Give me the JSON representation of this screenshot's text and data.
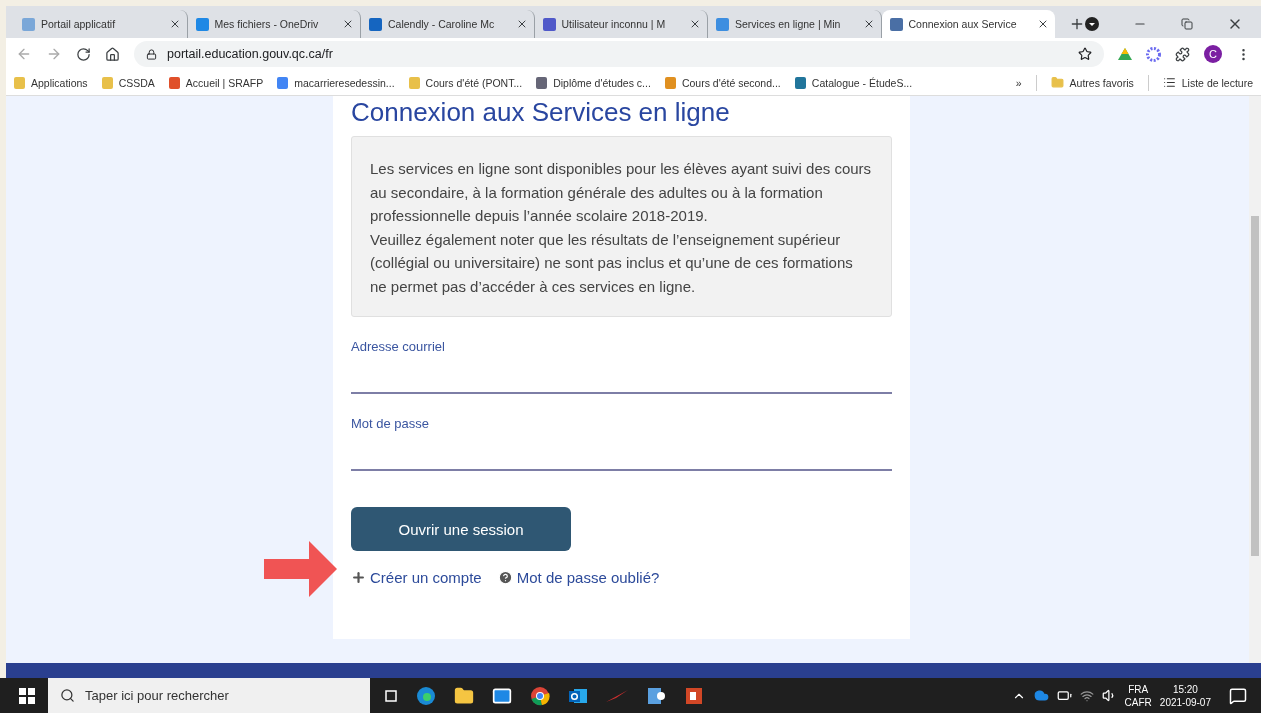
{
  "browser": {
    "tabs": [
      {
        "title": "Portail applicatif",
        "selected": false
      },
      {
        "title": "Mes fichiers - OneDriv",
        "selected": false
      },
      {
        "title": "Calendly - Caroline Mc",
        "selected": false
      },
      {
        "title": "Utilisateur inconnu | M",
        "selected": false
      },
      {
        "title": "Services en ligne | Min",
        "selected": false
      },
      {
        "title": "Connexion aux Service",
        "selected": true
      }
    ],
    "address": "portail.education.gouv.qc.ca/fr",
    "profile_initial": "C",
    "bookmarks": [
      {
        "label": "Applications"
      },
      {
        "label": "CSSDA"
      },
      {
        "label": "Accueil | SRAFP"
      },
      {
        "label": "macarrieresedessin..."
      },
      {
        "label": "Cours d'été (PONT..."
      },
      {
        "label": "Diplôme d'études c..."
      },
      {
        "label": "Cours d'été second..."
      },
      {
        "label": "Catalogue - ÉtudeS..."
      }
    ],
    "bookmarks_overflow": "»",
    "other_bookmarks": "Autres favoris",
    "reading_list": "Liste de lecture"
  },
  "page": {
    "heading": "Connexion aux Services en ligne",
    "notice": [
      "Les services en ligne sont disponibles pour les élèves ayant suivi des cours au secondaire, à la formation générale des adultes ou à la formation professionnelle depuis l’année scolaire 2018-2019.",
      "Veuillez également noter que les résultats de l’enseignement supérieur (collégial ou universitaire) ne sont pas inclus et qu’une de ces formations ne permet pas d’accéder à ces services en ligne."
    ],
    "fields": [
      {
        "label": "Adresse courriel"
      },
      {
        "label": "Mot de passe"
      }
    ],
    "submit": "Ouvrir une session",
    "links": [
      {
        "kind": "create",
        "label": "Créer un compte"
      },
      {
        "kind": "help",
        "label": "Mot de passe oublié?"
      }
    ]
  },
  "taskbar": {
    "search_placeholder": "Taper ici pour rechercher",
    "language": "FRA",
    "layout": "CAFR",
    "time": "15:20",
    "date": "2021-09-07"
  }
}
